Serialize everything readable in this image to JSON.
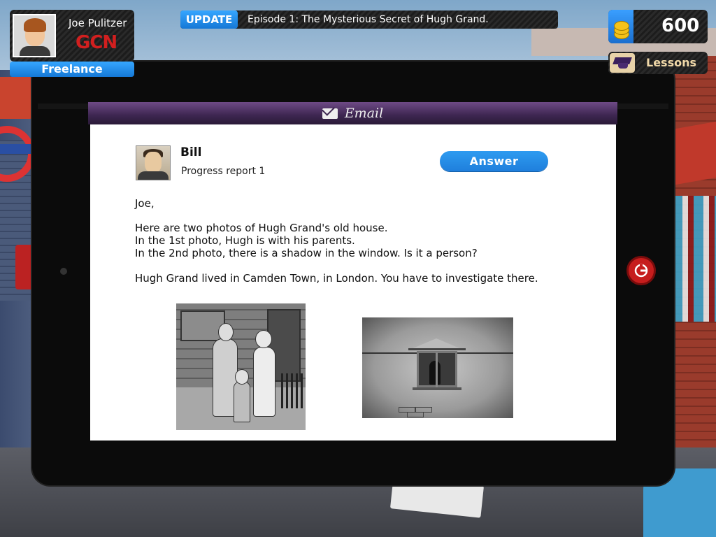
{
  "hud": {
    "player_name": "Joe Pulitzer",
    "company_logo": "GCN",
    "rank": "Freelance",
    "update_tag": "UPDATE",
    "update_text": "Episode 1: The Mysterious Secret of Hugh Grand.",
    "coins": "600",
    "lessons_label": "Lessons"
  },
  "email": {
    "window_title": "Email",
    "sender": "Bill",
    "subject": "Progress report 1",
    "answer_label": "Answer",
    "lines": [
      "Joe,",
      "Here are two photos of Hugh Grand's old house.",
      "In the 1st photo, Hugh is with his parents.",
      "In the 2nd photo, there is a shadow in the window. Is it a person?",
      "Hugh Grand lived in Camden Town, in London. You have to investigate there."
    ]
  },
  "icons": {
    "envelope": "envelope-icon",
    "coin": "coin-stack-icon",
    "cap": "graduation-cap-icon",
    "home": "exit-icon"
  },
  "colors": {
    "accent_blue": "#1f7fdc",
    "email_header": "#3d2650",
    "logo_red": "#d21f1f",
    "exit_red": "#c61d1d"
  }
}
